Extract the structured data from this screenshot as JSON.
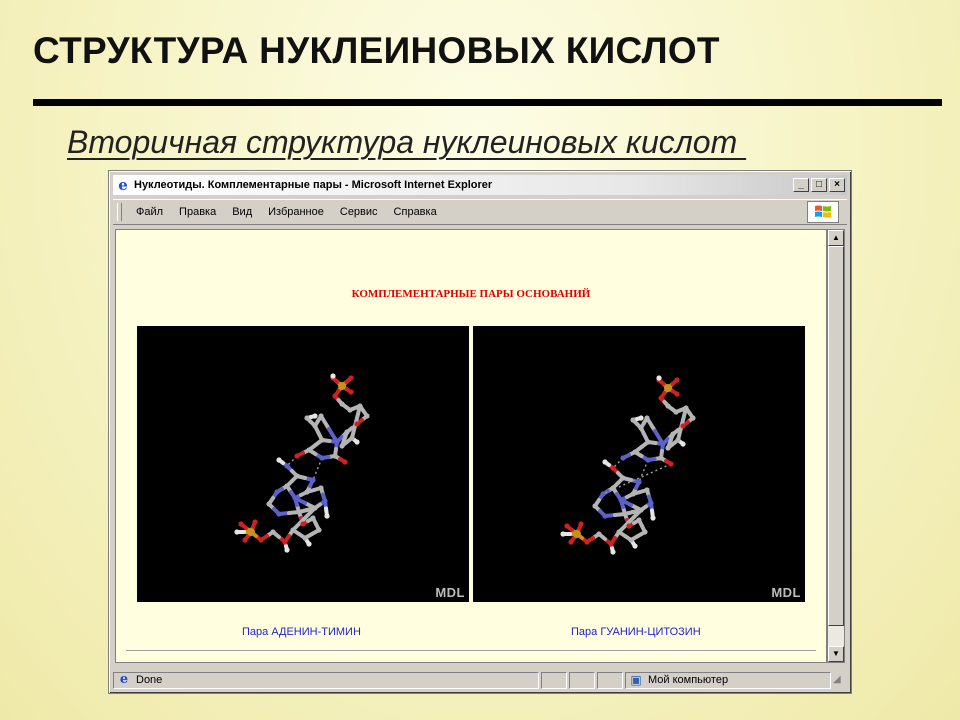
{
  "slide": {
    "title": "СТРУКТУРА НУКЛЕИНОВЫХ КИСЛОТ",
    "subtitle": "Вторичная структура нуклеиновых кислот "
  },
  "browser": {
    "title": "Нуклеотиды. Комплементарные пары - Microsoft Internet Explorer",
    "controls": {
      "minimize": "_",
      "maximize": "□",
      "close": "×"
    },
    "menu": [
      "Файл",
      "Правка",
      "Вид",
      "Избранное",
      "Сервис",
      "Справка"
    ],
    "status": {
      "text": "Done",
      "zone": "Мой компьютер"
    }
  },
  "page": {
    "heading": "КОМПЛЕМЕНТАРНЫЕ ПАРЫ ОСНОВАНИЙ",
    "panels": [
      {
        "watermark": "MDL",
        "caption": "Пара АДЕНИН-ТИМИН"
      },
      {
        "watermark": "MDL",
        "caption": "Пара ГУАНИН-ЦИТОЗИН"
      }
    ]
  },
  "icons": {
    "ie": "internet-explorer-icon",
    "windows": "windows-logo-icon",
    "done": "page-done-icon",
    "zone": "my-computer-icon"
  },
  "colors": {
    "heading": "#e00000",
    "caption": "#2222cc",
    "carbon": "#b4b4b4",
    "nitrogen": "#5a62c8",
    "oxygen": "#d02020",
    "phosphorus": "#c8901c",
    "hydrogen": "#e6e6e6"
  }
}
